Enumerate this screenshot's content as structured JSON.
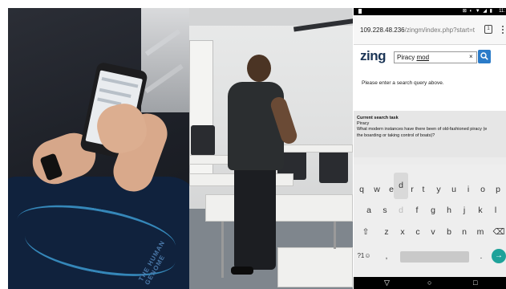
{
  "status_bar": {
    "time": "11:",
    "icons": "⊠ ◐ ▼ ◢ ▮"
  },
  "browser": {
    "url_host": "109.228.48.236",
    "url_path": "/zingm/index.php?start=t",
    "tab_count": "1"
  },
  "page": {
    "logo": "zing",
    "search": {
      "value_plain": "Piracy ",
      "value_typed": "mod"
    },
    "clear_label": "×",
    "prompt": "Please enter a search query above."
  },
  "task": {
    "title": "Current search task",
    "topic": "Piracy",
    "question_line1": "What modern instances have there been of old-fashioned piracy (e",
    "question_line2": "the boarding or taking control of boats)?"
  },
  "keyboard": {
    "row1": [
      "q",
      "w",
      "e",
      "r",
      "t",
      "y",
      "u",
      "i",
      "o",
      "p"
    ],
    "row1_popped": "d",
    "row2": [
      "a",
      "s",
      "d",
      "f",
      "g",
      "h",
      "j",
      "k",
      "l"
    ],
    "row3": [
      "z",
      "x",
      "c",
      "v",
      "b",
      "n",
      "m"
    ],
    "row4_symbols": "?1☺",
    "row4_comma": ",",
    "row4_period": ".",
    "shift_icon": "⇧",
    "backspace_icon": "⌫",
    "go_icon": "→"
  },
  "navbar": {
    "back": "▽",
    "home": "○",
    "recents": "□"
  },
  "shirt_text": "THE HUMAN GENOME"
}
